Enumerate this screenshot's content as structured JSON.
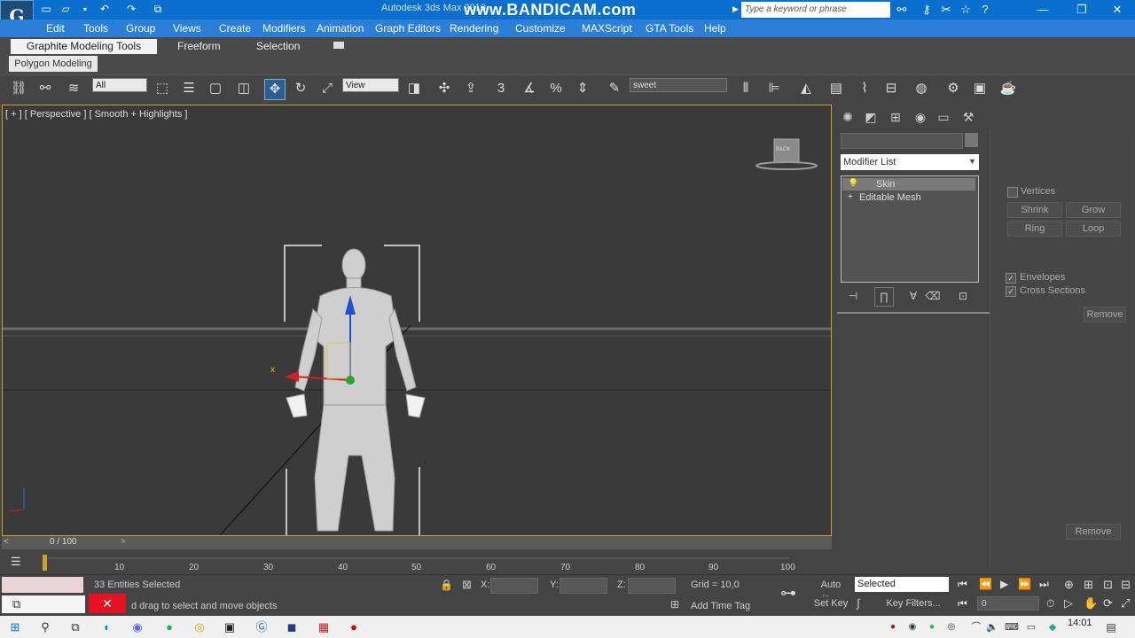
{
  "titlebar": {
    "app_title": "Autodesk 3ds Max 2010",
    "watermark": "www.BANDICAM.com",
    "search_placeholder": "Type a keyword or phrase"
  },
  "menu": [
    "Edit",
    "Tools",
    "Group",
    "Views",
    "Create",
    "Modifiers",
    "Animation",
    "Graph Editors",
    "Rendering",
    "Customize",
    "MAXScript",
    "GTA Tools",
    "Help"
  ],
  "ribbon": {
    "tabs": [
      "Graphite Modeling Tools",
      "Freeform",
      "Selection"
    ],
    "subtab": "Polygon Modeling"
  },
  "toolbar": {
    "filter_value": "All",
    "ref_coord_value": "View",
    "named_selection_value": "sweet"
  },
  "viewport": {
    "label": "[ + ] [ Perspective ] [ Smooth + Highlights ]",
    "viewcube_label": "BACK",
    "axis_x": "x"
  },
  "command_panel": {
    "modifier_list": "Modifier List",
    "stack": [
      "Skin",
      "Editable Mesh"
    ],
    "vertices_label": "Vertices",
    "buttons": [
      "Shrink",
      "Grow",
      "Ring",
      "Loop"
    ],
    "envelopes_label": "Envelopes",
    "cross_sections_label": "Cross Sections",
    "remove_label": "Remove"
  },
  "timeline": {
    "frame_label": "0 / 100",
    "ticks": [
      "10",
      "20",
      "30",
      "40",
      "50",
      "60",
      "70",
      "80",
      "90",
      "100"
    ]
  },
  "status": {
    "selection": "33 Entities Selected",
    "prompt": "d drag to select and move objects",
    "x_label": "X:",
    "y_label": "Y:",
    "z_label": "Z:",
    "grid": "Grid = 10,0",
    "add_time_tag": "Add Time Tag",
    "auto_key": "Auto Key",
    "set_key": "Set Key",
    "key_mode": "Selected",
    "key_filters": "Key Filters...",
    "frame_value": "0"
  },
  "taskbar": {
    "clock": "14:01"
  }
}
